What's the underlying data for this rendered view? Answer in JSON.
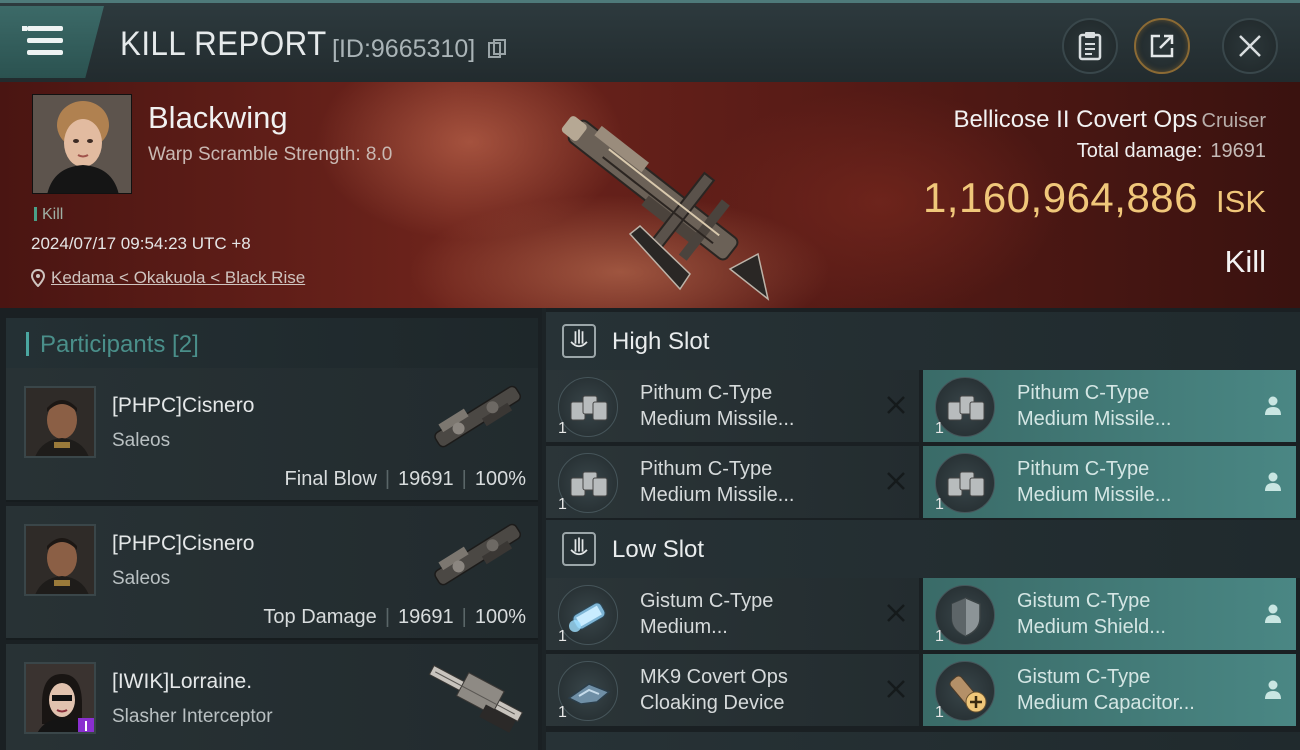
{
  "header": {
    "title": "KILL REPORT",
    "report_id": "[ID:9665310]"
  },
  "victim": {
    "name": "Blackwing",
    "subtitle": "Warp Scramble Strength: 8.0",
    "tag": "Kill",
    "datetime": "2024/07/17 09:54:23 UTC +8",
    "location": "Kedama < Okakuola < Black Rise",
    "ship": "Bellicose II Covert Ops",
    "ship_class": "Cruiser",
    "total_damage_label": "Total damage:",
    "total_damage": "19691",
    "isk_amount": "1,160,964,886",
    "isk_unit": "ISK",
    "result": "Kill"
  },
  "participants": {
    "label": "Participants [2]",
    "rows": [
      {
        "name": "[PHPC]Cisnero",
        "ship": "Saleos",
        "role": "Final Blow",
        "damage": "19691",
        "percent": "100%"
      },
      {
        "name": "[PHPC]Cisnero",
        "ship": "Saleos",
        "role": "Top Damage",
        "damage": "19691",
        "percent": "100%"
      },
      {
        "name": "[IWIK]Lorraine.",
        "ship": "Slasher Interceptor"
      }
    ]
  },
  "fittings": {
    "high_slot": {
      "label": "High Slot",
      "modules": [
        {
          "line1": "Pithum C-Type",
          "line2": "Medium Missile...",
          "qty": "1",
          "state": "destroyed"
        },
        {
          "line1": "Pithum C-Type",
          "line2": "Medium Missile...",
          "qty": "1",
          "state": "dropped"
        },
        {
          "line1": "Pithum C-Type",
          "line2": "Medium Missile...",
          "qty": "1",
          "state": "destroyed"
        },
        {
          "line1": "Pithum C-Type",
          "line2": "Medium Missile...",
          "qty": "1",
          "state": "dropped"
        }
      ]
    },
    "low_slot": {
      "label": "Low Slot",
      "modules": [
        {
          "line1": "Gistum C-Type",
          "line2": "Medium...",
          "qty": "1",
          "state": "destroyed"
        },
        {
          "line1": "Gistum C-Type",
          "line2": "Medium Shield...",
          "qty": "1",
          "state": "dropped"
        },
        {
          "line1": "MK9 Covert Ops",
          "line2": "Cloaking Device",
          "qty": "1",
          "state": "destroyed"
        },
        {
          "line1": "Gistum C-Type",
          "line2": "Medium Capacitor...",
          "qty": "1",
          "state": "dropped"
        }
      ]
    }
  },
  "colors": {
    "accent_teal": "#4a8784",
    "isk_gold": "#f0c77a",
    "hero_red": "#6e241c"
  }
}
